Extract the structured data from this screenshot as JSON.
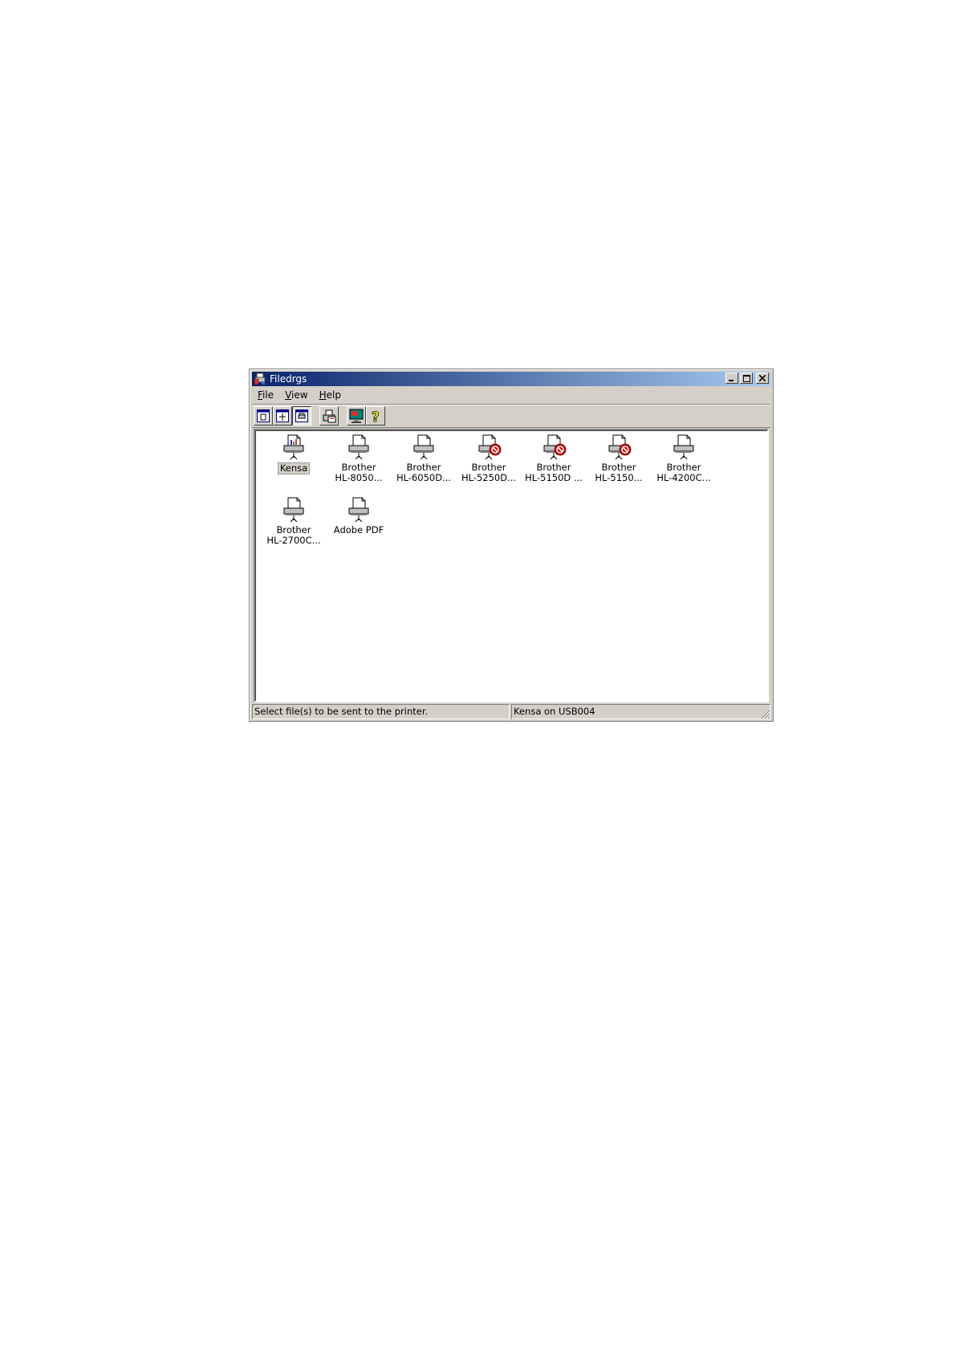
{
  "window": {
    "title": "Filedrgs"
  },
  "menu": {
    "items": [
      {
        "label": "File",
        "underline": "F",
        "rest": "ile"
      },
      {
        "label": "View",
        "underline": "V",
        "rest": "iew"
      },
      {
        "label": "Help",
        "underline": "H",
        "rest": "elp"
      }
    ]
  },
  "toolbar": {
    "buttons": [
      {
        "icon": "large-icons-view-icon",
        "pressed": false
      },
      {
        "icon": "small-icons-view-icon",
        "pressed": false
      },
      {
        "icon": "list-view-icon",
        "pressed": true
      },
      {
        "icon": "printer-properties-icon",
        "pressed": false
      },
      {
        "icon": "display-icon",
        "pressed": false
      },
      {
        "icon": "help-icon",
        "pressed": false
      }
    ]
  },
  "printers": [
    {
      "line1": "Kensa",
      "line2": "",
      "selected": true,
      "status": "default"
    },
    {
      "line1": "Brother",
      "line2": "HL-8050...",
      "selected": false,
      "status": "normal"
    },
    {
      "line1": "Brother",
      "line2": "HL-6050D...",
      "selected": false,
      "status": "normal"
    },
    {
      "line1": "Brother",
      "line2": "HL-5250D...",
      "selected": false,
      "status": "offline"
    },
    {
      "line1": "Brother",
      "line2": "HL-5150D ...",
      "selected": false,
      "status": "offline"
    },
    {
      "line1": "Brother",
      "line2": "HL-5150...",
      "selected": false,
      "status": "offline"
    },
    {
      "line1": "Brother",
      "line2": "HL-4200C...",
      "selected": false,
      "status": "normal"
    },
    {
      "line1": "Brother",
      "line2": "HL-2700C...",
      "selected": false,
      "status": "normal"
    },
    {
      "line1": "Adobe PDF",
      "line2": "",
      "selected": false,
      "status": "normal"
    }
  ],
  "statusbar": {
    "hint": "Select file(s) to be sent to the printer.",
    "printer": "Kensa on USB004"
  },
  "colors": {
    "title_start": "#0a246a",
    "title_end": "#a6caf0",
    "chrome": "#d4d0c8",
    "offline_badge": "#cc0000"
  }
}
